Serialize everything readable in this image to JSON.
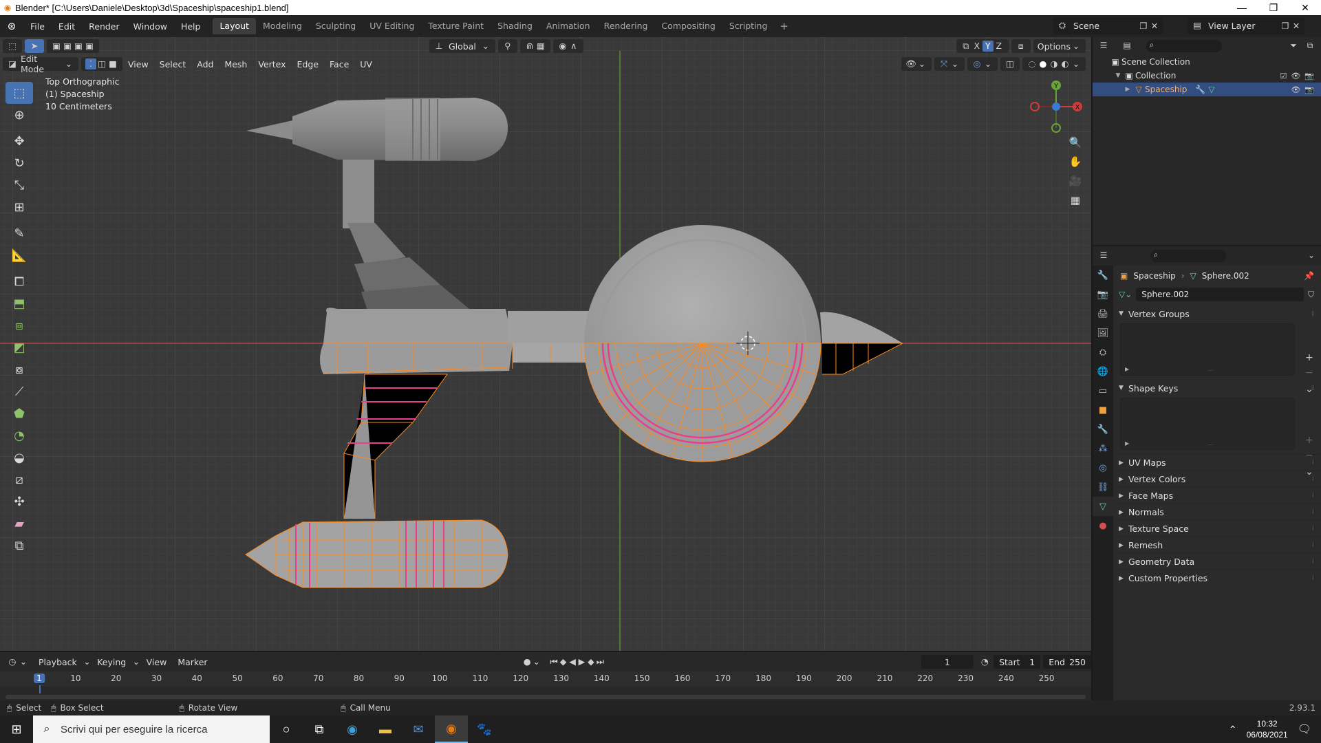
{
  "window": {
    "title": "Blender* [C:\\Users\\Daniele\\Desktop\\3d\\Spaceship\\spaceship1.blend]",
    "controls": [
      "—",
      "❐",
      "✕"
    ]
  },
  "topbar": {
    "menus": [
      "File",
      "Edit",
      "Render",
      "Window",
      "Help"
    ],
    "workspaces": [
      "Layout",
      "Modeling",
      "Sculpting",
      "UV Editing",
      "Texture Paint",
      "Shading",
      "Animation",
      "Rendering",
      "Compositing",
      "Scripting"
    ],
    "active_workspace": "Layout",
    "add_label": "+",
    "scene": "Scene",
    "view_layer": "View Layer"
  },
  "viewport": {
    "mode": "Edit Mode",
    "menus": [
      "View",
      "Select",
      "Add",
      "Mesh",
      "Vertex",
      "Edge",
      "Face",
      "UV"
    ],
    "orientation": "Global",
    "options_label": "Options",
    "axes": [
      "X",
      "Y",
      "Z"
    ],
    "info": {
      "view_name": "Top Orthographic",
      "object": "(1) Spaceship",
      "scale": "10 Centimeters"
    },
    "gizmo_labels": [
      "Y",
      "X"
    ],
    "colors": {
      "background": "#393939",
      "selected_edge": "#ff8a1c",
      "seam": "#e83e8c",
      "x_axis": "#d03c3c",
      "y_axis": "#6aa33a"
    }
  },
  "outliner": {
    "root": "Scene Collection",
    "collection": "Collection",
    "object": "Spaceship"
  },
  "properties": {
    "breadcrumb_object": "Spaceship",
    "breadcrumb_mesh": "Sphere.002",
    "mesh_name": "Sphere.002",
    "panels_open": [
      "Vertex Groups",
      "Shape Keys"
    ],
    "panels_closed": [
      "UV Maps",
      "Vertex Colors",
      "Face Maps",
      "Normals",
      "Texture Space",
      "Remesh",
      "Geometry Data",
      "Custom Properties"
    ]
  },
  "timeline": {
    "menus": [
      "Playback",
      "Keying",
      "View",
      "Marker"
    ],
    "current_frame": "1",
    "start_label": "Start",
    "start_value": "1",
    "end_label": "End",
    "end_value": "250",
    "ticks": [
      "1",
      "10",
      "20",
      "30",
      "40",
      "50",
      "60",
      "70",
      "80",
      "90",
      "100",
      "110",
      "120",
      "130",
      "140",
      "150",
      "160",
      "170",
      "180",
      "190",
      "200",
      "210",
      "220",
      "230",
      "240",
      "250"
    ]
  },
  "statusbar": {
    "items": [
      "Select",
      "Box Select",
      "Rotate View",
      "Call Menu"
    ],
    "version": "2.93.1"
  },
  "taskbar": {
    "search_placeholder": "Scrivi qui per eseguire la ricerca",
    "time": "10:32",
    "date": "06/08/2021"
  }
}
